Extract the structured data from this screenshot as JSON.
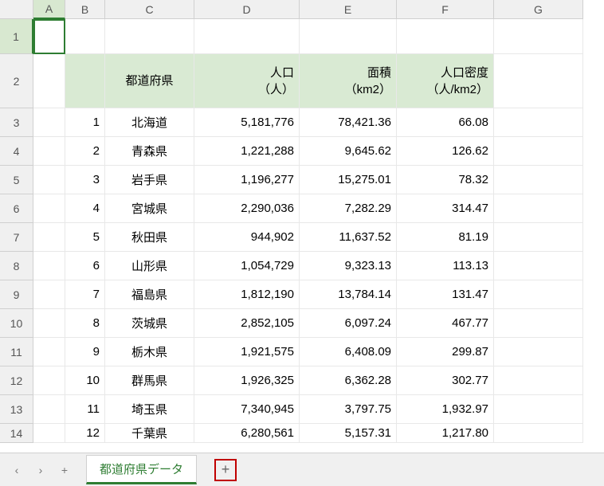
{
  "columns": [
    {
      "letter": "A",
      "width": 40
    },
    {
      "letter": "B",
      "width": 50
    },
    {
      "letter": "C",
      "width": 112
    },
    {
      "letter": "D",
      "width": 132
    },
    {
      "letter": "E",
      "width": 122
    },
    {
      "letter": "F",
      "width": 122
    },
    {
      "letter": "G",
      "width": 112
    }
  ],
  "rowNumbers": [
    1,
    2,
    3,
    4,
    5,
    6,
    7,
    8,
    9,
    10,
    11,
    12,
    13,
    14
  ],
  "rowHeights": {
    "default": 36,
    "1": 44,
    "2": 68,
    "14": 24
  },
  "selectedCell": "A1",
  "headers": {
    "prefecture": "都道府県",
    "population": "人口\n（人）",
    "area": "面積\n（km2）",
    "density": "人口密度\n（人/km2）"
  },
  "rows": [
    {
      "num": "1",
      "name": "北海道",
      "pop": "5,181,776",
      "area": "78,421.36",
      "density": "66.08"
    },
    {
      "num": "2",
      "name": "青森県",
      "pop": "1,221,288",
      "area": "9,645.62",
      "density": "126.62"
    },
    {
      "num": "3",
      "name": "岩手県",
      "pop": "1,196,277",
      "area": "15,275.01",
      "density": "78.32"
    },
    {
      "num": "4",
      "name": "宮城県",
      "pop": "2,290,036",
      "area": "7,282.29",
      "density": "314.47"
    },
    {
      "num": "5",
      "name": "秋田県",
      "pop": "944,902",
      "area": "11,637.52",
      "density": "81.19"
    },
    {
      "num": "6",
      "name": "山形県",
      "pop": "1,054,729",
      "area": "9,323.13",
      "density": "113.13"
    },
    {
      "num": "7",
      "name": "福島県",
      "pop": "1,812,190",
      "area": "13,784.14",
      "density": "131.47"
    },
    {
      "num": "8",
      "name": "茨城県",
      "pop": "2,852,105",
      "area": "6,097.24",
      "density": "467.77"
    },
    {
      "num": "9",
      "name": "栃木県",
      "pop": "1,921,575",
      "area": "6,408.09",
      "density": "299.87"
    },
    {
      "num": "10",
      "name": "群馬県",
      "pop": "1,926,325",
      "area": "6,362.28",
      "density": "302.77"
    },
    {
      "num": "11",
      "name": "埼玉県",
      "pop": "7,340,945",
      "area": "3,797.75",
      "density": "1,932.97"
    },
    {
      "num": "12",
      "name": "千葉県",
      "pop": "6,280,561",
      "area": "5,157.31",
      "density": "1,217.80"
    }
  ],
  "sheetTab": "都道府県データ",
  "nav": {
    "prev": "‹",
    "next": "›",
    "add": "+"
  },
  "addSheetLabel": "+"
}
